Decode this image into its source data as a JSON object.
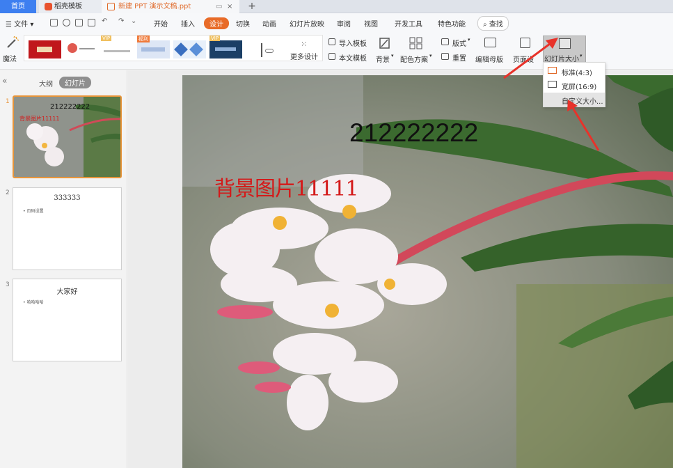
{
  "tabs": {
    "home": "首页",
    "templates": "稻壳模板",
    "doc": "新建 PPT 演示文稿.ppt",
    "new_tab": "+",
    "close": "×"
  },
  "menu": {
    "file": "文件",
    "items": [
      "开始",
      "插入",
      "设计",
      "切换",
      "动画",
      "幻灯片放映",
      "审阅",
      "视图",
      "开发工具",
      "特色功能"
    ],
    "active": "设计",
    "search": "查找"
  },
  "ribbon": {
    "magic": "魔法",
    "more_designs": "更多设计",
    "import_template": "导入模板",
    "this_template": "本文模板",
    "background": "背景",
    "color_scheme": "配色方案",
    "layout": "版式",
    "reset": "重置",
    "edit_master": "编辑母版",
    "page_setup": "页面设",
    "slide_size": "幻灯片大小",
    "vip1": "VIP",
    "vip2": "福利",
    "vip3": "VIP"
  },
  "slide_size_menu": [
    "标准(4:3)",
    "宽屏(16:9)",
    "自定义大小..."
  ],
  "panel": {
    "outline": "大纲",
    "slides": "幻灯片",
    "collapse": "«"
  },
  "thumbnails": [
    {
      "num": "1",
      "title": "212222222",
      "sub": "背景图片11111"
    },
    {
      "num": "2",
      "title": "333333",
      "bullet": "• 页码设置"
    },
    {
      "num": "3",
      "title": "大家好",
      "bullet": "• 哈哈哈哈"
    }
  ],
  "slide": {
    "title": "212222222",
    "text": "背景图片11111"
  },
  "colors": {
    "accent": "#e86b28",
    "home_tab": "#3d7ff0",
    "arrow": "#e8322a",
    "slide_text_red": "#d41a1a"
  }
}
